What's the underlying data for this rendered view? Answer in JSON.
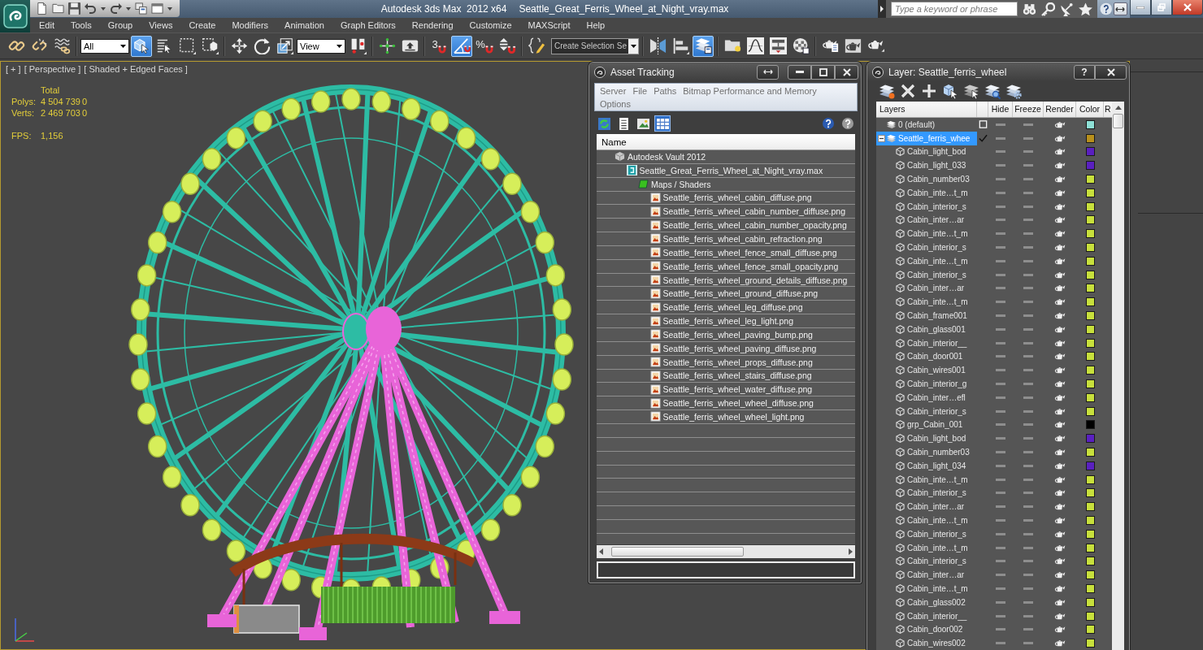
{
  "title_bar": {
    "app_title": "Autodesk 3ds Max  2012 x64",
    "file_name": "Seattle_Great_Ferris_Wheel_at_Night_vray.max",
    "search": {
      "placeholder": "Type a keyword or phrase"
    }
  },
  "menu_bar": [
    "Edit",
    "Tools",
    "Group",
    "Views",
    "Create",
    "Modifiers",
    "Animation",
    "Graph Editors",
    "Rendering",
    "Customize",
    "MAXScript",
    "Help"
  ],
  "main_toolbar": [
    [
      {
        "kind": "link",
        "active": false
      },
      {
        "kind": "unlink",
        "active": false
      },
      {
        "kind": "bind",
        "active": false
      }
    ],
    [
      {
        "kind": "dropdown",
        "value": "All"
      },
      {
        "kind": "select",
        "active": true
      },
      {
        "kind": "select_by_name",
        "active": false
      },
      {
        "kind": "region",
        "active": false
      },
      {
        "kind": "crossing",
        "active": false
      }
    ],
    [
      {
        "kind": "move",
        "active": false
      },
      {
        "kind": "rotate",
        "active": false
      },
      {
        "kind": "scale",
        "active": false
      },
      {
        "kind": "dropdown",
        "value": "View"
      },
      {
        "kind": "pivot",
        "active": false
      }
    ],
    [
      {
        "kind": "manipulate",
        "active": false
      },
      {
        "kind": "shortcut",
        "active": false
      }
    ],
    [
      {
        "kind": "snap",
        "glyph": "3",
        "active": false
      },
      {
        "kind": "angle_snap",
        "active": true
      },
      {
        "kind": "percent_snap",
        "glyph": "%",
        "active": false
      },
      {
        "kind": "spinner_snap",
        "active": false
      }
    ],
    [
      {
        "kind": "named_sets",
        "active": false
      },
      {
        "kind": "combo",
        "value": "Create Selection Se"
      }
    ],
    [
      {
        "kind": "mirror",
        "active": false
      },
      {
        "kind": "align",
        "active": false
      },
      {
        "kind": "layers",
        "active": true
      }
    ],
    [
      {
        "kind": "explorer",
        "active": false
      },
      {
        "kind": "curves",
        "active": false
      },
      {
        "kind": "schematic",
        "active": false
      },
      {
        "kind": "material",
        "active": false
      }
    ],
    [
      {
        "kind": "render_setup",
        "active": false
      },
      {
        "kind": "frame_window",
        "active": false
      },
      {
        "kind": "render",
        "active": false
      }
    ]
  ],
  "viewport": {
    "active": true,
    "labels": [
      "[ + ]",
      "[ Perspective ]",
      "[ Shaded + Edged Faces ]"
    ],
    "stats": {
      "header": "Total",
      "groups": [
        [
          {
            "label": "Polys:",
            "values": [
              "4 504 739",
              "0"
            ]
          },
          {
            "label": "Verts:",
            "values": [
              "2 469 703",
              "0"
            ]
          }
        ],
        [
          {
            "label": "FPS:",
            "values": [
              "1,156"
            ]
          }
        ]
      ]
    }
  },
  "asset_tracking": {
    "title": "Asset Tracking",
    "menu": [
      "Server",
      "File",
      "Paths",
      "Bitmap Performance and Memory",
      "Options"
    ],
    "toolbar": [
      {
        "kind": "refresh",
        "selected": false
      },
      {
        "kind": "list",
        "selected": false
      },
      {
        "kind": "thumbnails",
        "selected": false
      },
      {
        "kind": "table",
        "selected": true
      }
    ],
    "header": "Name",
    "tree": [
      {
        "kind": "vault",
        "label": "Autodesk Vault 2012",
        "children": [
          {
            "kind": "max_file",
            "label": "Seattle_Great_Ferris_Wheel_at_Night_vray.max",
            "children": [
              {
                "kind": "folder",
                "label": "Maps / Shaders",
                "children": [
                  {
                    "kind": "bitmap",
                    "label": "Seattle_ferris_wheel_cabin_diffuse.png"
                  },
                  {
                    "kind": "bitmap",
                    "label": "Seattle_ferris_wheel_cabin_number_diffuse.png"
                  },
                  {
                    "kind": "bitmap",
                    "label": "Seattle_ferris_wheel_cabin_number_opacity.png"
                  },
                  {
                    "kind": "bitmap",
                    "label": "Seattle_ferris_wheel_cabin_refraction.png"
                  },
                  {
                    "kind": "bitmap",
                    "label": "Seattle_ferris_wheel_fence_small_diffuse.png"
                  },
                  {
                    "kind": "bitmap",
                    "label": "Seattle_ferris_wheel_fence_small_opacity.png"
                  },
                  {
                    "kind": "bitmap",
                    "label": "Seattle_ferris_wheel_ground_details_diffuse.png"
                  },
                  {
                    "kind": "bitmap",
                    "label": "Seattle_ferris_wheel_ground_diffuse.png"
                  },
                  {
                    "kind": "bitmap",
                    "label": "Seattle_ferris_wheel_leg_diffuse.png"
                  },
                  {
                    "kind": "bitmap",
                    "label": "Seattle_ferris_wheel_leg_light.png"
                  },
                  {
                    "kind": "bitmap",
                    "label": "Seattle_ferris_wheel_paving_bump.png"
                  },
                  {
                    "kind": "bitmap",
                    "label": "Seattle_ferris_wheel_paving_diffuse.png"
                  },
                  {
                    "kind": "bitmap",
                    "label": "Seattle_ferris_wheel_props_diffuse.png"
                  },
                  {
                    "kind": "bitmap",
                    "label": "Seattle_ferris_wheel_stairs_diffuse.png"
                  },
                  {
                    "kind": "bitmap",
                    "label": "Seattle_ferris_wheel_water_diffuse.png"
                  },
                  {
                    "kind": "bitmap",
                    "label": "Seattle_ferris_wheel_wheel_diffuse.png"
                  },
                  {
                    "kind": "bitmap",
                    "label": "Seattle_ferris_wheel_wheel_light.png"
                  }
                ]
              }
            ]
          }
        ]
      }
    ]
  },
  "layer_manager": {
    "title": "Layer: Seattle_ferris_wheel",
    "help_button": "?",
    "columns": [
      "Layers",
      "Hide",
      "Freeze",
      "Render",
      "Color",
      "R"
    ],
    "layers": [
      {
        "name": "0 (default)",
        "selected": false,
        "current": false,
        "hidden": false,
        "frozen": false,
        "render": true,
        "color": "#8ee0d6"
      },
      {
        "name": "Seattle_ferris_whee",
        "selected": true,
        "current": true,
        "expanded": true,
        "hidden": false,
        "frozen": false,
        "render": true,
        "color": "#b8901c",
        "children": [
          {
            "name": "Cabin_light_bod",
            "selected": false,
            "hidden": false,
            "frozen": false,
            "render": true,
            "color": "#5a20c0"
          },
          {
            "name": "Cabin_light_033",
            "selected": false,
            "hidden": false,
            "frozen": false,
            "render": true,
            "color": "#5a20c0"
          },
          {
            "name": "Cabin_number03",
            "selected": false,
            "hidden": false,
            "frozen": false,
            "render": true,
            "color": "#c8e03c"
          },
          {
            "name": "Cabin_inte…t_m",
            "selected": false,
            "hidden": false,
            "frozen": false,
            "render": true,
            "color": "#c8e03c"
          },
          {
            "name": "Cabin_interior_s",
            "selected": false,
            "hidden": false,
            "frozen": false,
            "render": true,
            "color": "#c8e03c"
          },
          {
            "name": "Cabin_inter…ar",
            "selected": false,
            "hidden": false,
            "frozen": false,
            "render": true,
            "color": "#c8e03c"
          },
          {
            "name": "Cabin_inte…t_m",
            "selected": false,
            "hidden": false,
            "frozen": false,
            "render": true,
            "color": "#c8e03c"
          },
          {
            "name": "Cabin_interior_s",
            "selected": false,
            "hidden": false,
            "frozen": false,
            "render": true,
            "color": "#c8e03c"
          },
          {
            "name": "Cabin_inte…t_m",
            "selected": false,
            "hidden": false,
            "frozen": false,
            "render": true,
            "color": "#c8e03c"
          },
          {
            "name": "Cabin_interior_s",
            "selected": false,
            "hidden": false,
            "frozen": false,
            "render": true,
            "color": "#c8e03c"
          },
          {
            "name": "Cabin_inter…ar",
            "selected": false,
            "hidden": false,
            "frozen": false,
            "render": true,
            "color": "#c8e03c"
          },
          {
            "name": "Cabin_inte…t_m",
            "selected": false,
            "hidden": false,
            "frozen": false,
            "render": true,
            "color": "#c8e03c"
          },
          {
            "name": "Cabin_frame001",
            "selected": false,
            "hidden": false,
            "frozen": false,
            "render": true,
            "color": "#c8e03c"
          },
          {
            "name": "Cabin_glass001",
            "selected": false,
            "hidden": false,
            "frozen": false,
            "render": true,
            "color": "#c8e03c"
          },
          {
            "name": "Cabin_interior__",
            "selected": false,
            "hidden": false,
            "frozen": false,
            "render": true,
            "color": "#c8e03c"
          },
          {
            "name": "Cabin_door001",
            "selected": false,
            "hidden": false,
            "frozen": false,
            "render": true,
            "color": "#c8e03c"
          },
          {
            "name": "Cabin_wires001",
            "selected": false,
            "hidden": false,
            "frozen": false,
            "render": true,
            "color": "#c8e03c"
          },
          {
            "name": "Cabin_interior_g",
            "selected": false,
            "hidden": false,
            "frozen": false,
            "render": true,
            "color": "#c8e03c"
          },
          {
            "name": "Cabin_inter…efl",
            "selected": false,
            "hidden": false,
            "frozen": false,
            "render": true,
            "color": "#c8e03c"
          },
          {
            "name": "Cabin_interior_s",
            "selected": false,
            "hidden": false,
            "frozen": false,
            "render": true,
            "color": "#c8e03c"
          },
          {
            "name": "grp_Cabin_001",
            "selected": false,
            "hidden": false,
            "frozen": false,
            "render": true,
            "color": "#000000"
          },
          {
            "name": "Cabin_light_bod",
            "selected": false,
            "hidden": false,
            "frozen": false,
            "render": true,
            "color": "#5a20c0"
          },
          {
            "name": "Cabin_number03",
            "selected": false,
            "hidden": false,
            "frozen": false,
            "render": true,
            "color": "#c8e03c"
          },
          {
            "name": "Cabin_light_034",
            "selected": false,
            "hidden": false,
            "frozen": false,
            "render": true,
            "color": "#5a20c0"
          },
          {
            "name": "Cabin_inte…t_m",
            "selected": false,
            "hidden": false,
            "frozen": false,
            "render": true,
            "color": "#c8e03c"
          },
          {
            "name": "Cabin_interior_s",
            "selected": false,
            "hidden": false,
            "frozen": false,
            "render": true,
            "color": "#c8e03c"
          },
          {
            "name": "Cabin_inter…ar",
            "selected": false,
            "hidden": false,
            "frozen": false,
            "render": true,
            "color": "#c8e03c"
          },
          {
            "name": "Cabin_inte…t_m",
            "selected": false,
            "hidden": false,
            "frozen": false,
            "render": true,
            "color": "#c8e03c"
          },
          {
            "name": "Cabin_interior_s",
            "selected": false,
            "hidden": false,
            "frozen": false,
            "render": true,
            "color": "#c8e03c"
          },
          {
            "name": "Cabin_inte…t_m",
            "selected": false,
            "hidden": false,
            "frozen": false,
            "render": true,
            "color": "#c8e03c"
          },
          {
            "name": "Cabin_interior_s",
            "selected": false,
            "hidden": false,
            "frozen": false,
            "render": true,
            "color": "#c8e03c"
          },
          {
            "name": "Cabin_inter…ar",
            "selected": false,
            "hidden": false,
            "frozen": false,
            "render": true,
            "color": "#c8e03c"
          },
          {
            "name": "Cabin_inte…t_m",
            "selected": false,
            "hidden": false,
            "frozen": false,
            "render": true,
            "color": "#c8e03c"
          },
          {
            "name": "Cabin_glass002",
            "selected": false,
            "hidden": false,
            "frozen": false,
            "render": true,
            "color": "#c8e03c"
          },
          {
            "name": "Cabin_interior__",
            "selected": false,
            "hidden": false,
            "frozen": false,
            "render": true,
            "color": "#c8e03c"
          },
          {
            "name": "Cabin_door002",
            "selected": false,
            "hidden": false,
            "frozen": false,
            "render": true,
            "color": "#c8e03c"
          },
          {
            "name": "Cabin_wires002",
            "selected": false,
            "hidden": false,
            "frozen": false,
            "render": true,
            "color": "#c8e03c"
          }
        ]
      }
    ]
  }
}
